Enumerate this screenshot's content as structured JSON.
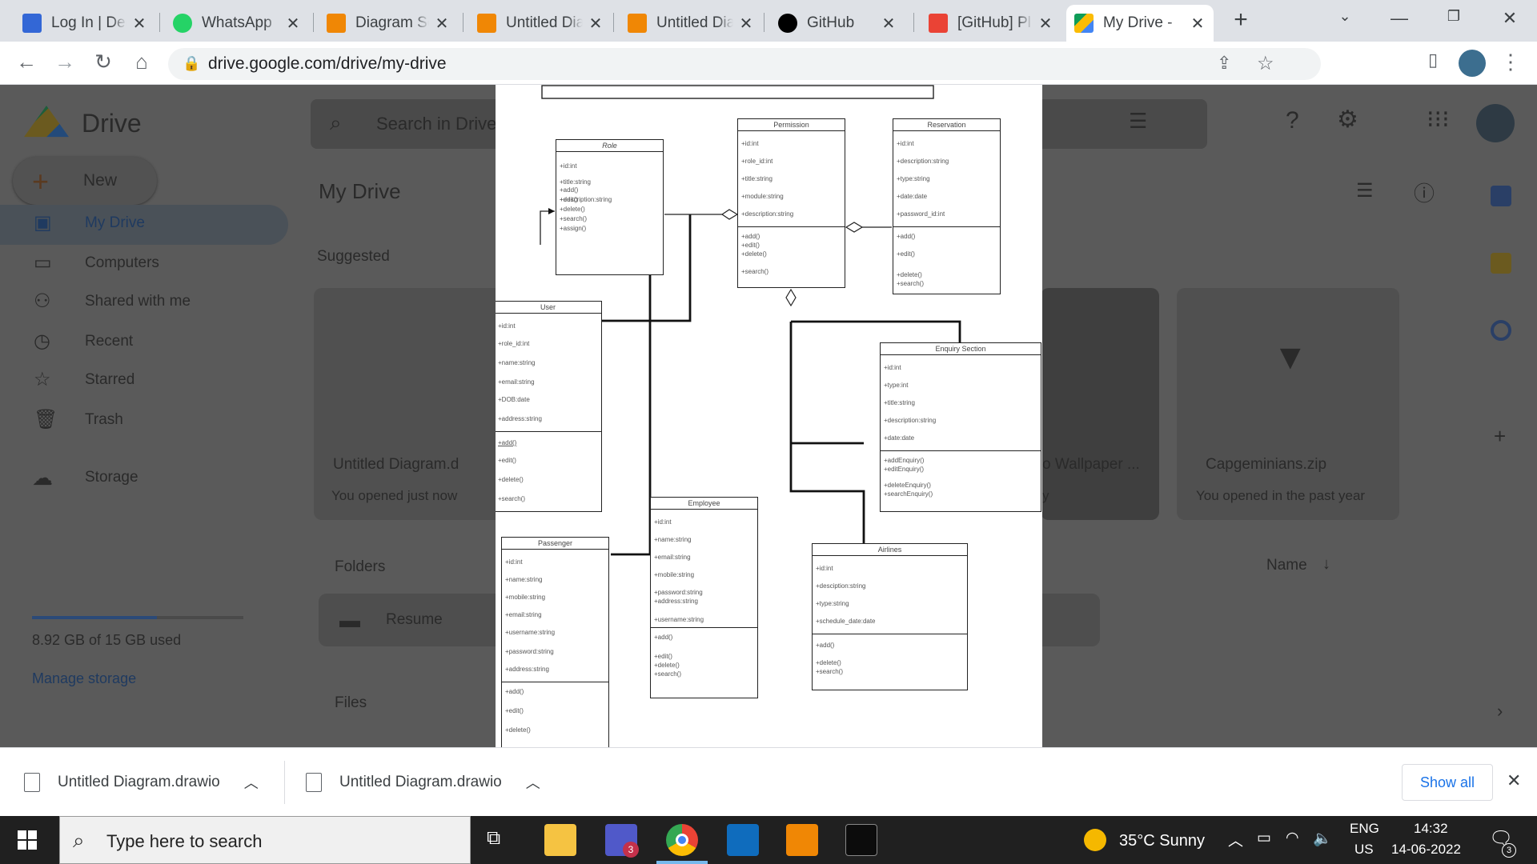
{
  "browser": {
    "tabs": [
      {
        "label": "Log In | Deg",
        "color": "#3367d6"
      },
      {
        "label": "WhatsApp",
        "color": "#25d366"
      },
      {
        "label": "Diagram Sc",
        "color": "#f08705"
      },
      {
        "label": "Untitled Dia",
        "color": "#f08705"
      },
      {
        "label": "Untitled Dia",
        "color": "#f08705"
      },
      {
        "label": "GitHub",
        "color": "#000000"
      },
      {
        "label": "[GitHub] Pl",
        "color": "#ea4335"
      },
      {
        "label": "My Drive - ",
        "color": "#0f9d58"
      }
    ],
    "new_tab": "+",
    "url": "drive.google.com/drive/my-drive"
  },
  "drive": {
    "logo": "Drive",
    "search_placeholder": "Search in Drive",
    "new_label": "New",
    "nav": [
      "My Drive",
      "Computers",
      "Shared with me",
      "Recent",
      "Starred",
      "Trash"
    ],
    "storage_label": "Storage",
    "storage_used": "8.92 GB of 15 GB used",
    "storage_fraction": 0.59,
    "manage_storage": "Manage storage",
    "header": "My Drive",
    "suggested": "Suggested",
    "folders": "Folders",
    "files": "Files",
    "name_sort": "Name",
    "folder_name": "Resume",
    "suggested_cards": [
      {
        "title": "Untitled Diagram.d",
        "sub": "You opened just now"
      },
      {
        "title": "o Wallpaper ...",
        "sub": "y"
      },
      {
        "title": "Capgeminians.zip",
        "sub": "You opened in the past year"
      }
    ]
  },
  "diagram": {
    "role": {
      "title": "Role",
      "attrs": [
        "+id:int",
        "+title:string",
        "+description:string"
      ],
      "ops": [
        "+add()",
        "+edit()",
        "+delete()",
        "+search()",
        "+assign()"
      ]
    },
    "permission": {
      "title": "Permission",
      "attrs": [
        "+id:int",
        "+role_id:int",
        "+title:string",
        "+module:string",
        "+description:string"
      ],
      "ops": [
        "+add()",
        "+edit()",
        "+delete()",
        "+search()"
      ]
    },
    "reservation": {
      "title": "Reservation",
      "attrs": [
        "+id:int",
        "+description:string",
        "+type:string",
        "+date:date",
        "+password_id:int"
      ],
      "ops": [
        "+add()",
        "+edit()",
        "+delete()",
        "+search()"
      ]
    },
    "user": {
      "title": "User",
      "attrs": [
        "+id:int",
        "+role_id:int",
        "+name:string",
        "+email:string",
        "+DOB:date",
        "+address:string"
      ],
      "ops": [
        "+add()",
        "+edit()",
        "+delete()",
        "+search()"
      ]
    },
    "enquiry": {
      "title": "Enquiry Section",
      "attrs": [
        "+id:int",
        "+type:int",
        "+title:string",
        "+description:string",
        "+date:date"
      ],
      "ops": [
        "+addEnquiry()",
        "+editEnquiry()",
        "+deleteEnquiry()",
        "+searchEnquiry()"
      ]
    },
    "employee": {
      "title": "Employee",
      "attrs": [
        "+id:int",
        "+name:string",
        "+email:string",
        "+mobile:string",
        "+password:string",
        "+address:string",
        "+username:string"
      ],
      "ops": [
        "+add()",
        "+edit()",
        "+delete()",
        "+search()"
      ]
    },
    "passenger": {
      "title": "Passenger",
      "attrs": [
        "+id:int",
        "+name:string",
        "+mobile:string",
        "+email:string",
        "+username:string",
        "+password:string",
        "+address:string"
      ],
      "ops": [
        "+add()",
        "+edit()",
        "+delete()"
      ]
    },
    "airlines": {
      "title": "Airlines",
      "attrs": [
        "+id:int",
        "+desciption:string",
        "+type:string",
        "+schedule_date:date"
      ],
      "ops": [
        "+add()",
        "+delete()",
        "+search()"
      ]
    }
  },
  "downloads": {
    "items": [
      "Untitled Diagram.drawio",
      "Untitled Diagram.drawio"
    ],
    "show_all": "Show all"
  },
  "taskbar": {
    "search_placeholder": "Type here to search",
    "teams_badge": "3",
    "weather": "35°C  Sunny",
    "lang": "ENG",
    "region": "US",
    "time": "14:32",
    "date": "14-06-2022",
    "notif_count": "3"
  }
}
